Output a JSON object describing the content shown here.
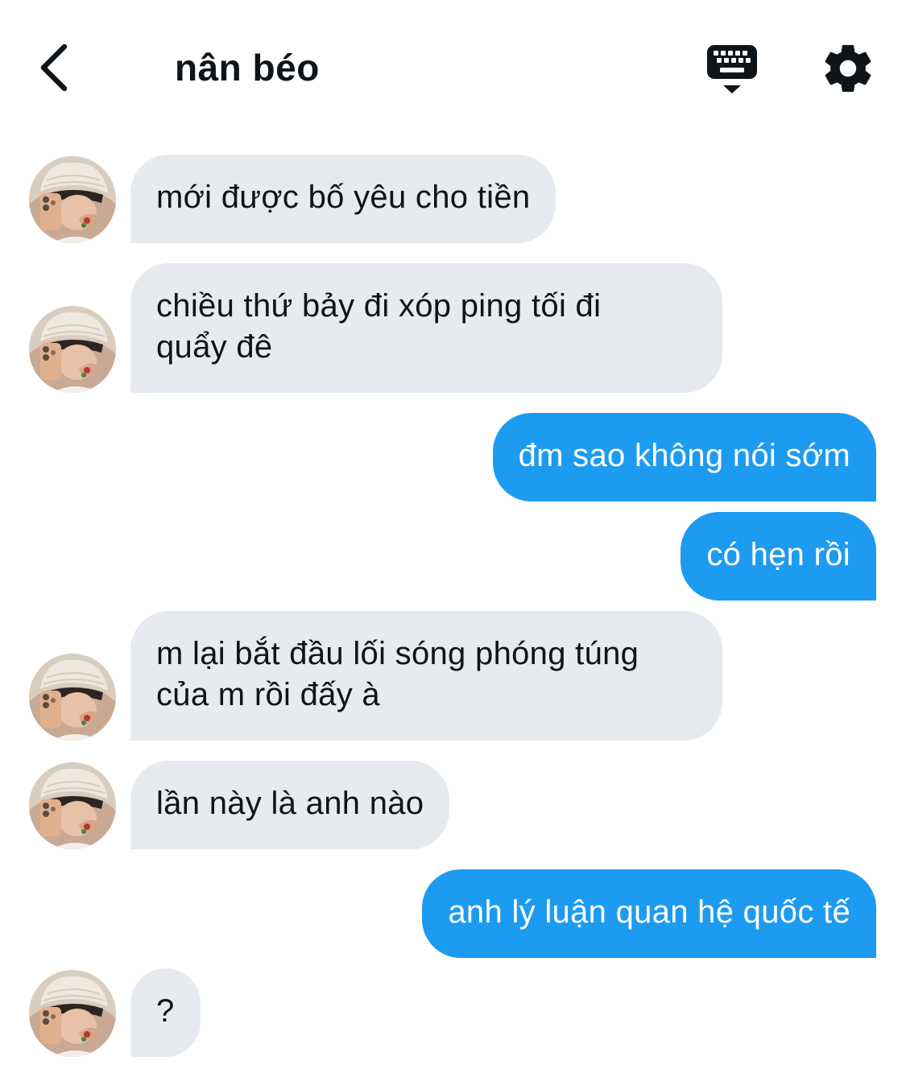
{
  "header": {
    "back_icon": "chevron-left-icon",
    "title": "nân béo",
    "keyboard_icon": "keyboard-icon",
    "settings_icon": "gear-icon"
  },
  "colors": {
    "incoming_bubble": "#e7eaee",
    "outgoing_bubble": "#1d9bf0",
    "text": "#0f1419"
  },
  "messages": [
    {
      "from": "them",
      "lines": [
        "mới được bố yêu cho tiền"
      ]
    },
    {
      "from": "them",
      "lines": [
        "chiều thứ bảy đi xóp ping tối đi",
        "quẩy đê"
      ]
    },
    {
      "from": "me",
      "lines": [
        "đm sao không nói sớm"
      ]
    },
    {
      "from": "me",
      "lines": [
        "có hẹn rồi"
      ]
    },
    {
      "from": "them",
      "lines": [
        "m lại bắt đầu lối sóng phóng túng",
        "của m rồi đấy à"
      ]
    },
    {
      "from": "them",
      "lines": [
        "lần này là anh nào"
      ]
    },
    {
      "from": "me",
      "lines": [
        "anh lý luận quan hệ quốc tế"
      ]
    },
    {
      "from": "them",
      "lines": [
        "?"
      ]
    }
  ]
}
